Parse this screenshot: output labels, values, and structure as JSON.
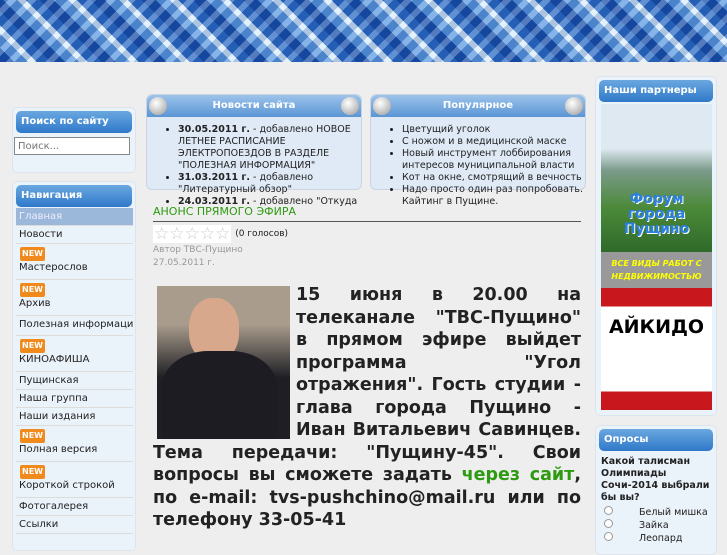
{
  "search": {
    "title": "Поиск по сайту",
    "placeholder": "Поиск..."
  },
  "nav": {
    "title": "Навигация",
    "new_badge": "NEW",
    "items": [
      "Главная",
      "Новости",
      "Мастерослов",
      "Архив",
      "Полезная информаци",
      "КИНОАФИША",
      "Пущинская",
      "Наша группа",
      "Наши издания",
      "Полная версия",
      "Короткой строкой",
      "Фотогалерея",
      "Ссылки"
    ]
  },
  "news": {
    "title": "Новости сайта",
    "items": [
      {
        "date": "30.05.2011 г.",
        "text": " - добавлено НОВОЕ ЛЕТНЕЕ РАСПИСАНИЕ ЭЛЕКТРОПОЕЗДОВ В РАЗДЕЛЕ \"ПОЛЕЗНАЯ ИНФОРМАЦИЯ\""
      },
      {
        "date": "31.03.2011 г.",
        "text": " - добавлено \"Литературный обзор\""
      },
      {
        "date": "24.03.2011 г.",
        "text": " - добавлено \"Откуда"
      }
    ]
  },
  "popular": {
    "title": "Популярное",
    "items": [
      "Цветущий уголок",
      "С ножом и в медицинской маске",
      "Новый инструмент лоббирования интересов муниципальной власти",
      "Кот на окне, смотрящий в вечность",
      "Надо просто один раз попробовать. Кайтинг в Пущине."
    ]
  },
  "article": {
    "title": "АНОНС ПРЯМОГО ЭФИРА",
    "votes": "(0 голосов)",
    "rating": 0,
    "author": "Автор ТВС-Пущино",
    "date": "27.05.2011 г.",
    "body1": "15 июня в 20.00 на телеканале \"ТВС-Пущино\" в прямом эфире выйдет программа \"Угол отражения\". Гость студии - глава города Пущино - Иван Витальевич Савинцев. Тема передачи: \"Пущину-45\". Свои вопросы вы сможете задать ",
    "link": "через сайт",
    "body2": ", по e-mail: tvs-pushchino@mail.ru или по телефону 33-05-41"
  },
  "partners": {
    "title": "Наши партнеры",
    "banner1": "Форум города Пущино",
    "banner1_sub": "ВСЕ ВИДЫ РАБОТ С НЕДВИЖИМОСТЬЮ",
    "banner2": "АЙКИДО"
  },
  "poll": {
    "title": "Опросы",
    "question": "Какой талисман Олимпиады Сочи-2014 выбрали бы вы?",
    "options": [
      "Белый мишка",
      "Зайка",
      "Леопард"
    ]
  }
}
